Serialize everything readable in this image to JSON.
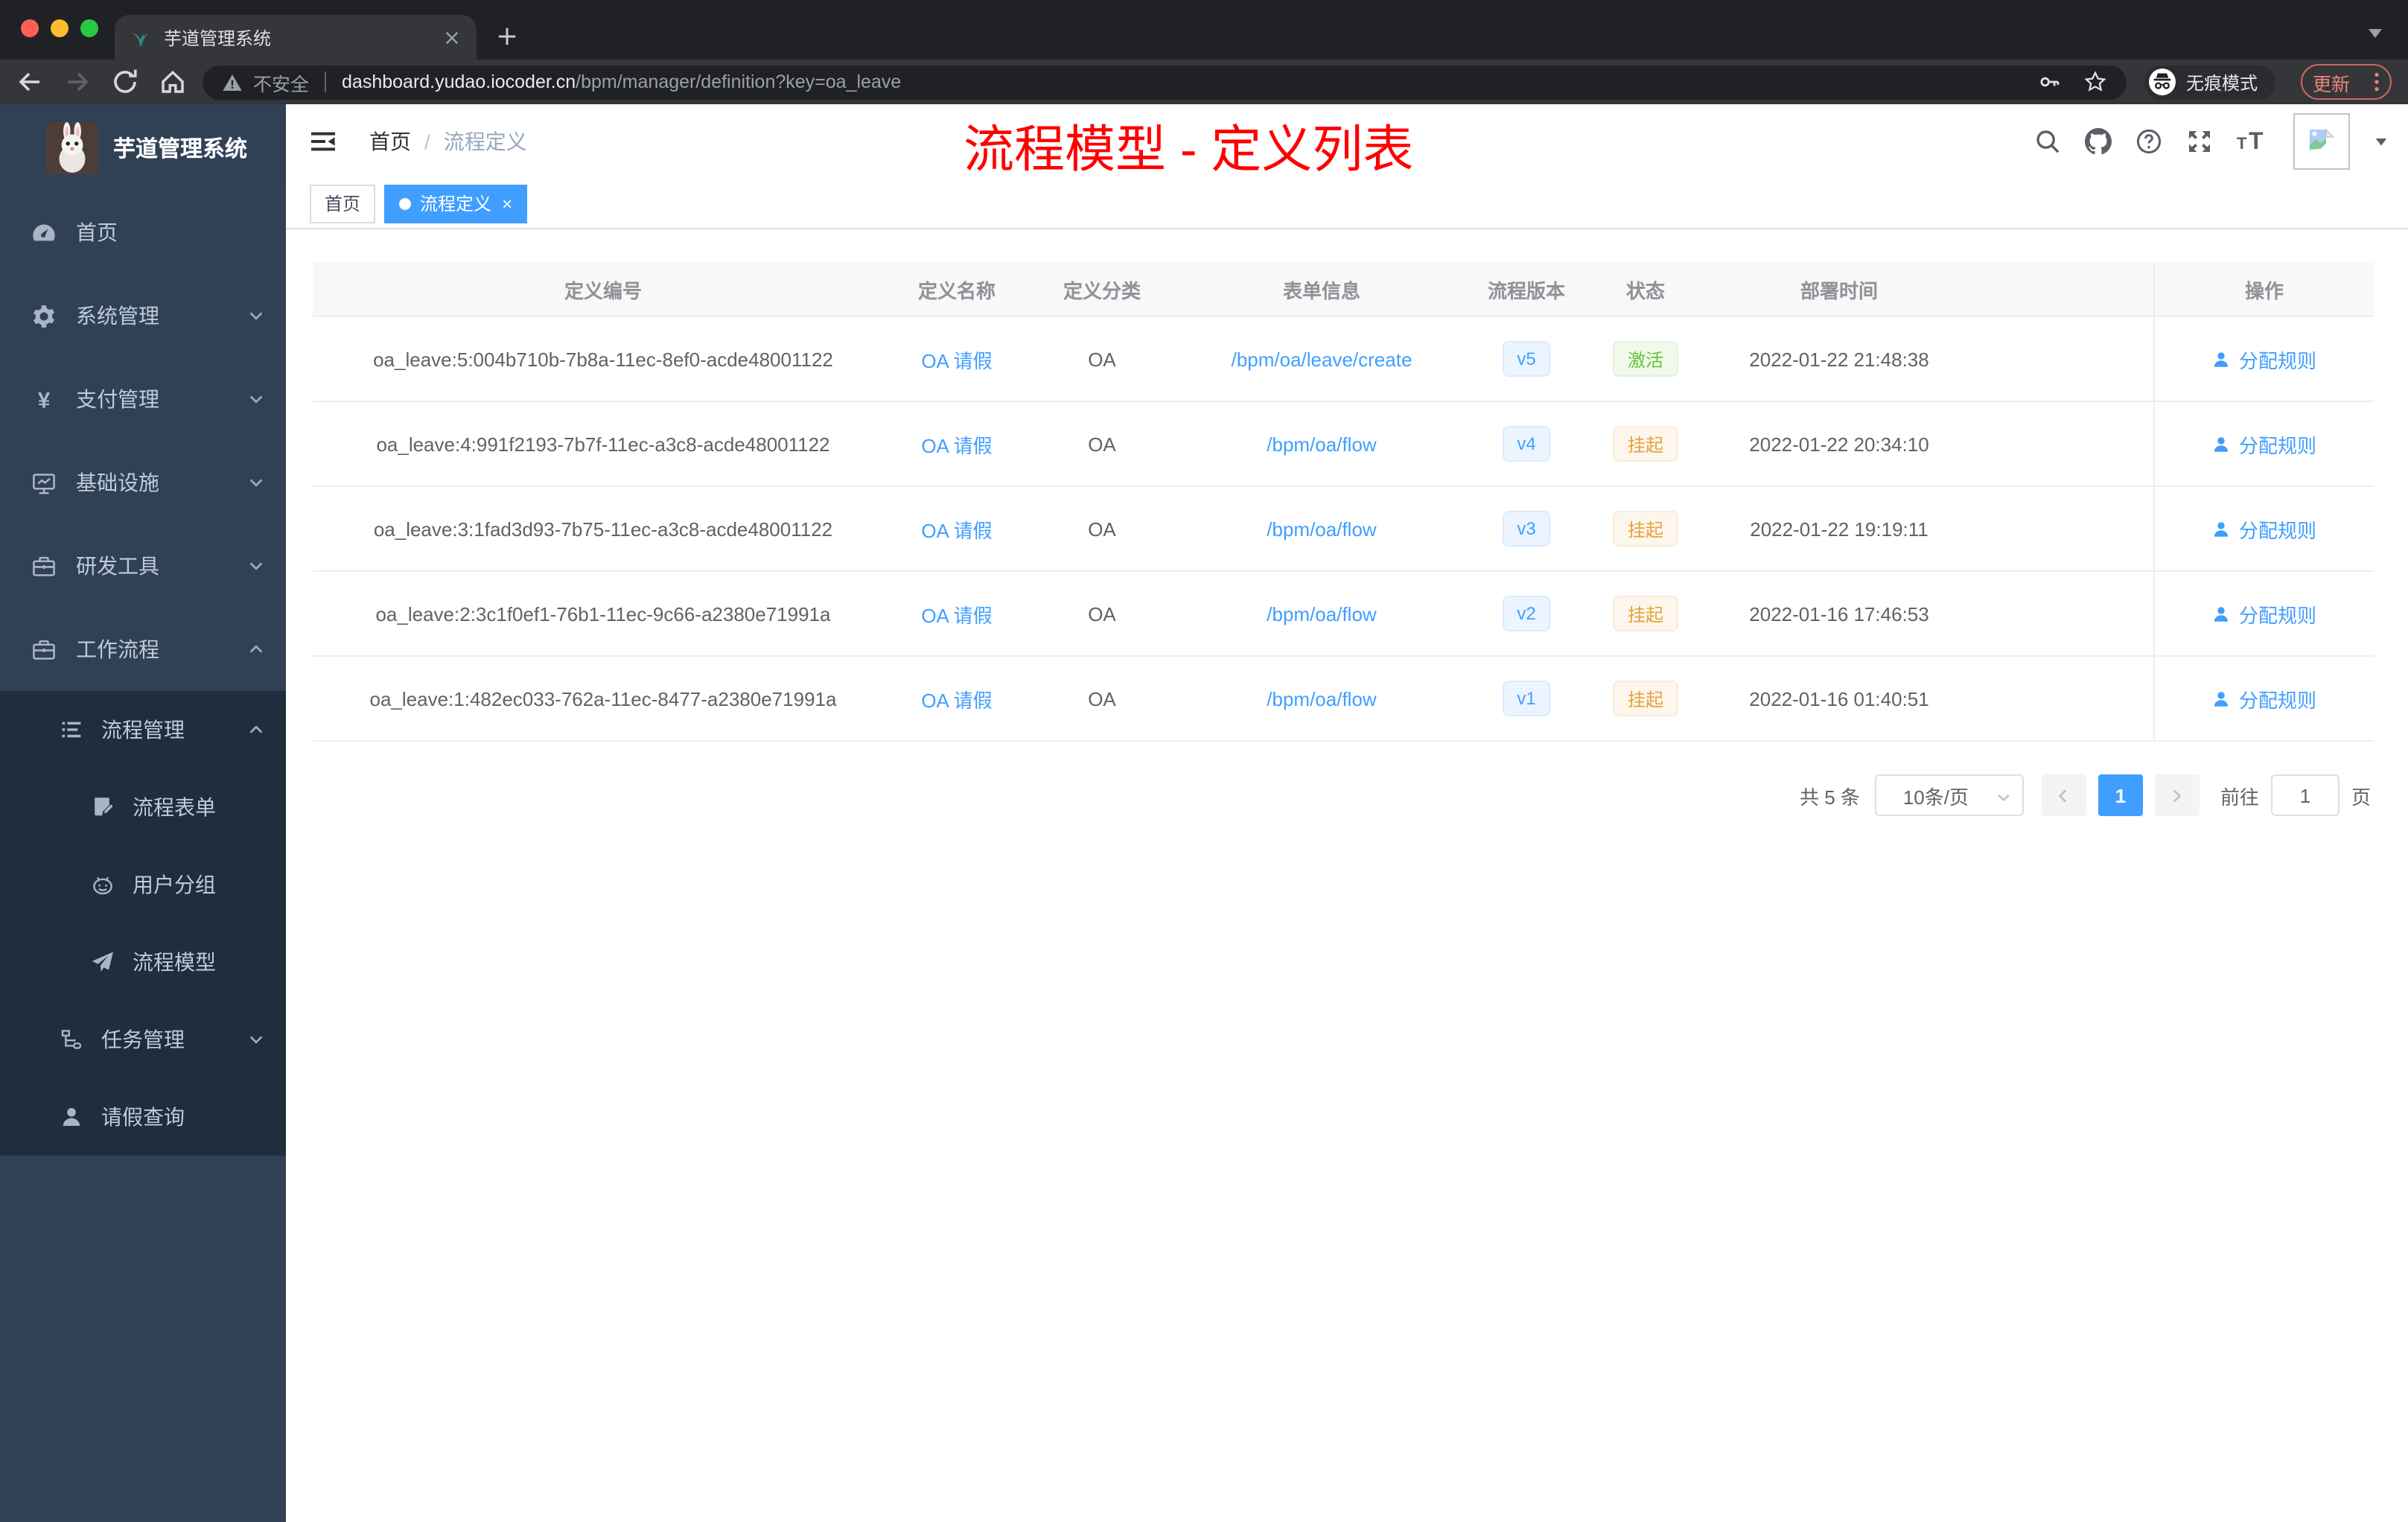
{
  "colors": {
    "accent": "#409eff",
    "success": "#67c23a",
    "warning": "#e6a23c",
    "annotation_red": "#ff0000",
    "sidebar_bg": "#304156",
    "submenu_bg": "#1f2d3d",
    "active_tag_bg": "#409eff"
  },
  "browser": {
    "tab_title": "芋道管理系统",
    "tab_close": "×",
    "security_label": "不安全",
    "url_host": "dashboard.yudao.iocoder.cn",
    "url_path": "/bpm/manager/definition?key=oa_leave",
    "incognito_label": "无痕模式",
    "update_label": "更新"
  },
  "sidebar": {
    "logo_title": "芋道管理系统",
    "menu": [
      {
        "label": "首页",
        "icon": "dashboard",
        "chevron": ""
      },
      {
        "label": "系统管理",
        "icon": "gear",
        "chevron": "down"
      },
      {
        "label": "支付管理",
        "icon": "yen",
        "chevron": "down"
      },
      {
        "label": "基础设施",
        "icon": "monitor",
        "chevron": "down"
      },
      {
        "label": "研发工具",
        "icon": "toolbox",
        "chevron": "down"
      },
      {
        "label": "工作流程",
        "icon": "toolbox",
        "chevron": "up"
      }
    ],
    "submenu": [
      {
        "label": "流程管理",
        "icon": "list-tree",
        "chevron": "up",
        "level": 1
      },
      {
        "label": "流程表单",
        "icon": "form-pen",
        "chevron": "",
        "level": 2
      },
      {
        "label": "用户分组",
        "icon": "robot",
        "chevron": "",
        "level": 2
      },
      {
        "label": "流程模型",
        "icon": "send",
        "chevron": "",
        "level": 2
      },
      {
        "label": "任务管理",
        "icon": "tree",
        "chevron": "down",
        "level": 1
      },
      {
        "label": "请假查询",
        "icon": "user",
        "chevron": "",
        "level": 1
      }
    ]
  },
  "navbar": {
    "breadcrumb_home": "首页",
    "breadcrumb_sep": "/",
    "breadcrumb_current": "流程定义"
  },
  "annotation": {
    "text": "流程模型 - 定义列表"
  },
  "tags": [
    {
      "label": "首页",
      "active": false,
      "closable": false
    },
    {
      "label": "流程定义",
      "active": true,
      "closable": true,
      "close_glyph": "×"
    }
  ],
  "table": {
    "columns": [
      "定义编号",
      "定义名称",
      "定义分类",
      "表单信息",
      "流程版本",
      "状态",
      "部署时间",
      "操作"
    ],
    "rows": [
      {
        "id": "oa_leave:5:004b710b-7b8a-11ec-8ef0-acde48001122",
        "name": "OA 请假",
        "category": "OA",
        "form": "/bpm/oa/leave/create",
        "version": "v5",
        "status": "激活",
        "status_type": "success",
        "time": "2022-01-22 21:48:38",
        "action": "分配规则"
      },
      {
        "id": "oa_leave:4:991f2193-7b7f-11ec-a3c8-acde48001122",
        "name": "OA 请假",
        "category": "OA",
        "form": "/bpm/oa/flow",
        "version": "v4",
        "status": "挂起",
        "status_type": "warning",
        "time": "2022-01-22 20:34:10",
        "action": "分配规则"
      },
      {
        "id": "oa_leave:3:1fad3d93-7b75-11ec-a3c8-acde48001122",
        "name": "OA 请假",
        "category": "OA",
        "form": "/bpm/oa/flow",
        "version": "v3",
        "status": "挂起",
        "status_type": "warning",
        "time": "2022-01-22 19:19:11",
        "action": "分配规则"
      },
      {
        "id": "oa_leave:2:3c1f0ef1-76b1-11ec-9c66-a2380e71991a",
        "name": "OA 请假",
        "category": "OA",
        "form": "/bpm/oa/flow",
        "version": "v2",
        "status": "挂起",
        "status_type": "warning",
        "time": "2022-01-16 17:46:53",
        "action": "分配规则"
      },
      {
        "id": "oa_leave:1:482ec033-762a-11ec-8477-a2380e71991a",
        "name": "OA 请假",
        "category": "OA",
        "form": "/bpm/oa/flow",
        "version": "v1",
        "status": "挂起",
        "status_type": "warning",
        "time": "2022-01-16 01:40:51",
        "action": "分配规则"
      }
    ]
  },
  "pagination": {
    "total": "共 5 条",
    "page_size": "10条/页",
    "current_page": "1",
    "goto_label": "前往",
    "goto_value": "1",
    "page_unit": "页"
  }
}
